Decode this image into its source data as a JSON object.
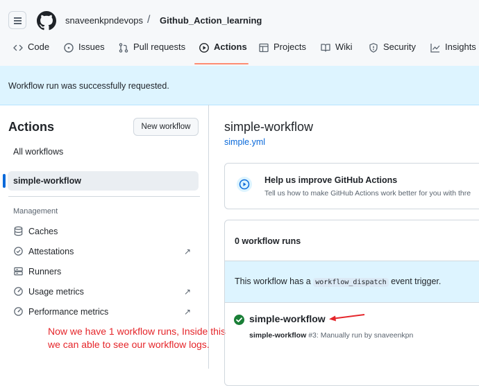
{
  "header": {
    "owner": "snaveenkpndevops",
    "separator": "/",
    "repo": "Github_Action_learning",
    "tabs": [
      {
        "label": "Code",
        "icon": "code-icon"
      },
      {
        "label": "Issues",
        "icon": "issue-icon"
      },
      {
        "label": "Pull requests",
        "icon": "pull-request-icon"
      },
      {
        "label": "Actions",
        "icon": "play-icon",
        "active": true
      },
      {
        "label": "Projects",
        "icon": "table-icon"
      },
      {
        "label": "Wiki",
        "icon": "book-icon"
      },
      {
        "label": "Security",
        "icon": "shield-icon"
      },
      {
        "label": "Insights",
        "icon": "graph-icon"
      }
    ]
  },
  "flash": {
    "message": "Workflow run was successfully requested."
  },
  "sidebar": {
    "title": "Actions",
    "new_workflow": "New workflow",
    "all_workflows": "All workflows",
    "selected_workflow": "simple-workflow",
    "management_heading": "Management",
    "management_items": [
      {
        "label": "Caches",
        "icon": "database-icon",
        "external": false
      },
      {
        "label": "Attestations",
        "icon": "verified-icon",
        "external": true
      },
      {
        "label": "Runners",
        "icon": "server-icon",
        "external": false
      },
      {
        "label": "Usage metrics",
        "icon": "meter-icon",
        "external": true
      },
      {
        "label": "Performance metrics",
        "icon": "meter-icon",
        "external": true
      }
    ],
    "external_glyph": "↗"
  },
  "annotation": {
    "note": "Now we have 1 workflow runs, Inside this we can able to see our workflow logs.",
    "color": "#e5252a"
  },
  "main": {
    "workflow_title": "simple-workflow",
    "workflow_file": "simple.yml",
    "promo": {
      "title": "Help us improve GitHub Actions",
      "subtitle": "Tell us how to make GitHub Actions work better for you with thre"
    },
    "runs_count": "0 workflow runs",
    "trigger": {
      "prefix": "This workflow has a",
      "code": "workflow_dispatch",
      "suffix": "event trigger."
    },
    "run": {
      "name": "simple-workflow",
      "workflow": "simple-workflow",
      "detail": "#3: Manually run by snaveenkpn",
      "status": "success"
    }
  },
  "colors": {
    "accent": "#0969da",
    "success": "#1a7f37",
    "tab_underline": "#fd8c73",
    "flash_bg": "#ddf4ff"
  }
}
